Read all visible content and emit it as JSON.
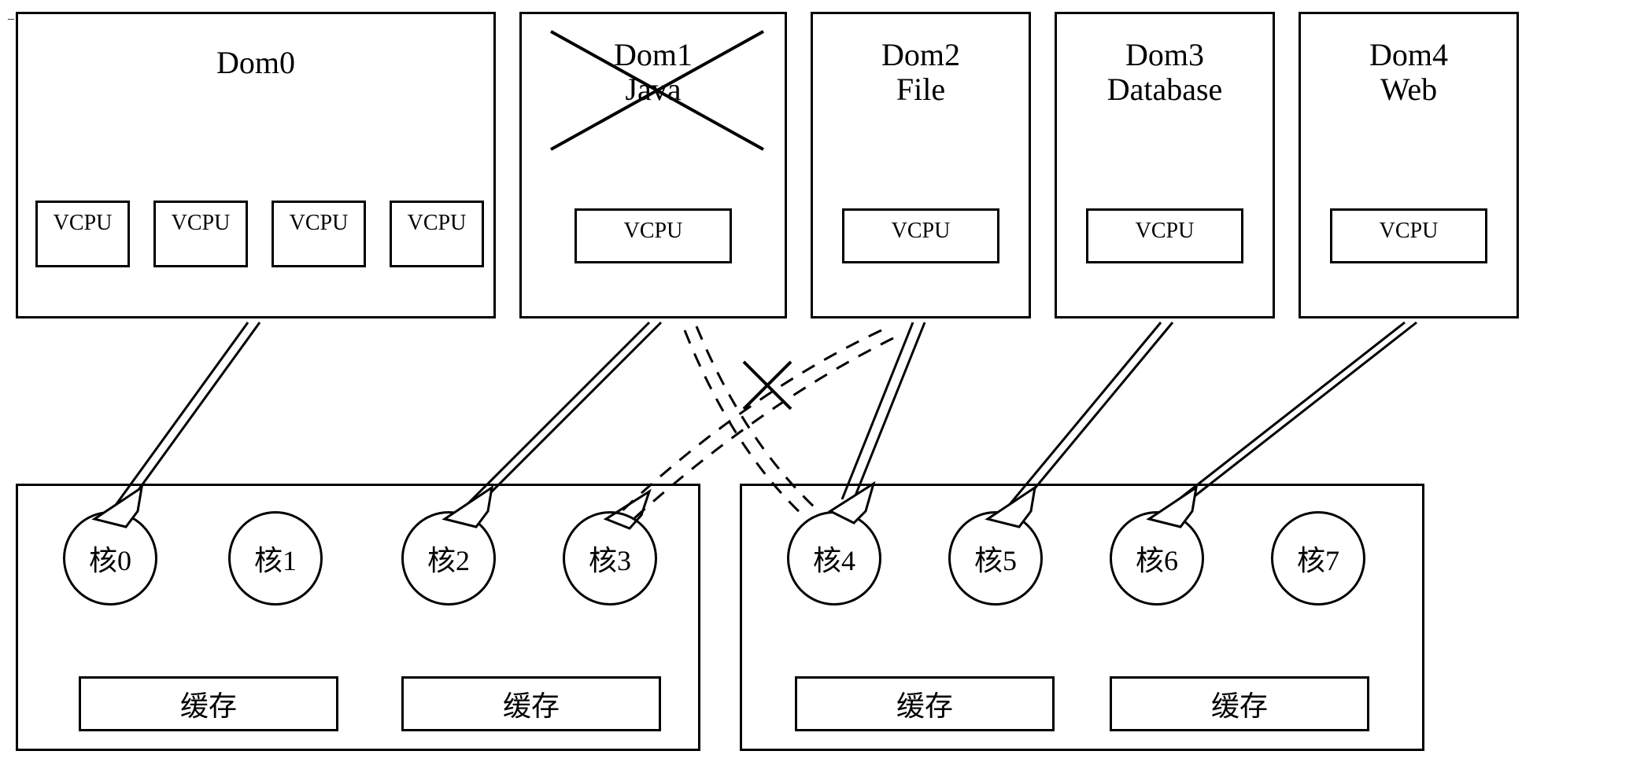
{
  "domains": {
    "dom0": {
      "title": "Dom0",
      "subtitle": "",
      "vcpu": "VCPU"
    },
    "dom1": {
      "title": "Dom1",
      "subtitle": "Java",
      "vcpu": "VCPU"
    },
    "dom2": {
      "title": "Dom2",
      "subtitle": "File",
      "vcpu": "VCPU"
    },
    "dom3": {
      "title": "Dom3",
      "subtitle": "Database",
      "vcpu": "VCPU"
    },
    "dom4": {
      "title": "Dom4",
      "subtitle": "Web",
      "vcpu": "VCPU"
    }
  },
  "cores": {
    "c0": "核0",
    "c1": "核1",
    "c2": "核2",
    "c3": "核3",
    "c4": "核4",
    "c5": "核5",
    "c6": "核6",
    "c7": "核7"
  },
  "cache": "缓存",
  "meta": {
    "dom1_removed": true,
    "migration_cancelled": "Dom2 → 核3 (cancelled)",
    "migration_new": "Dom1-area → 核4 (dashed)"
  }
}
